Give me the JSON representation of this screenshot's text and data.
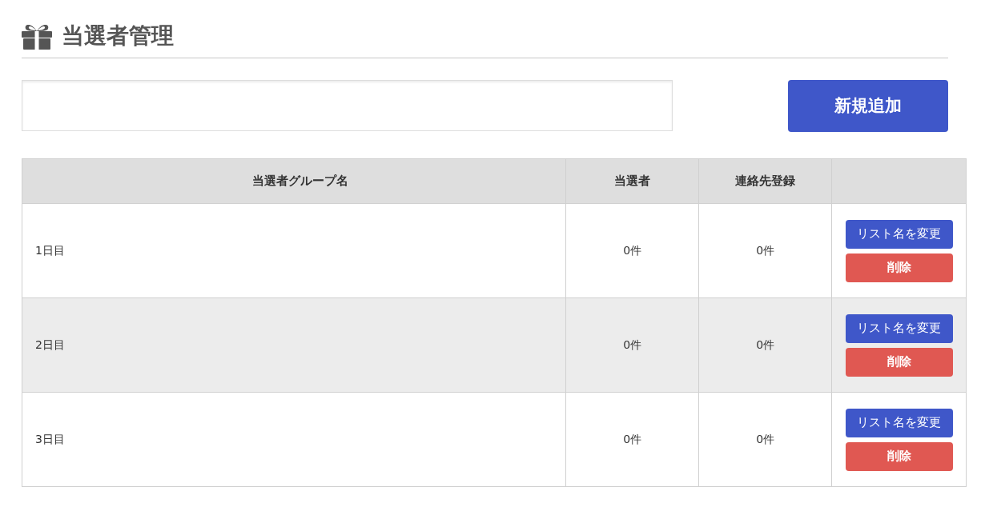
{
  "page": {
    "title": "当選者管理"
  },
  "toolbar": {
    "add_button": "新規追加"
  },
  "table": {
    "columns": [
      "当選者グループ名",
      "当選者",
      "連絡先登録"
    ],
    "rows": [
      {
        "name": "1日目",
        "winners": "0件",
        "contacts": "0件",
        "actions": [
          "リスト名を変更",
          "削除"
        ]
      },
      {
        "name": "2日目",
        "winners": "0件",
        "contacts": "0件",
        "actions": [
          "リスト名を変更",
          "削除"
        ]
      },
      {
        "name": "3日目",
        "winners": "0件",
        "contacts": "0件",
        "actions": [
          "リスト名を変更",
          "削除"
        ]
      }
    ]
  }
}
